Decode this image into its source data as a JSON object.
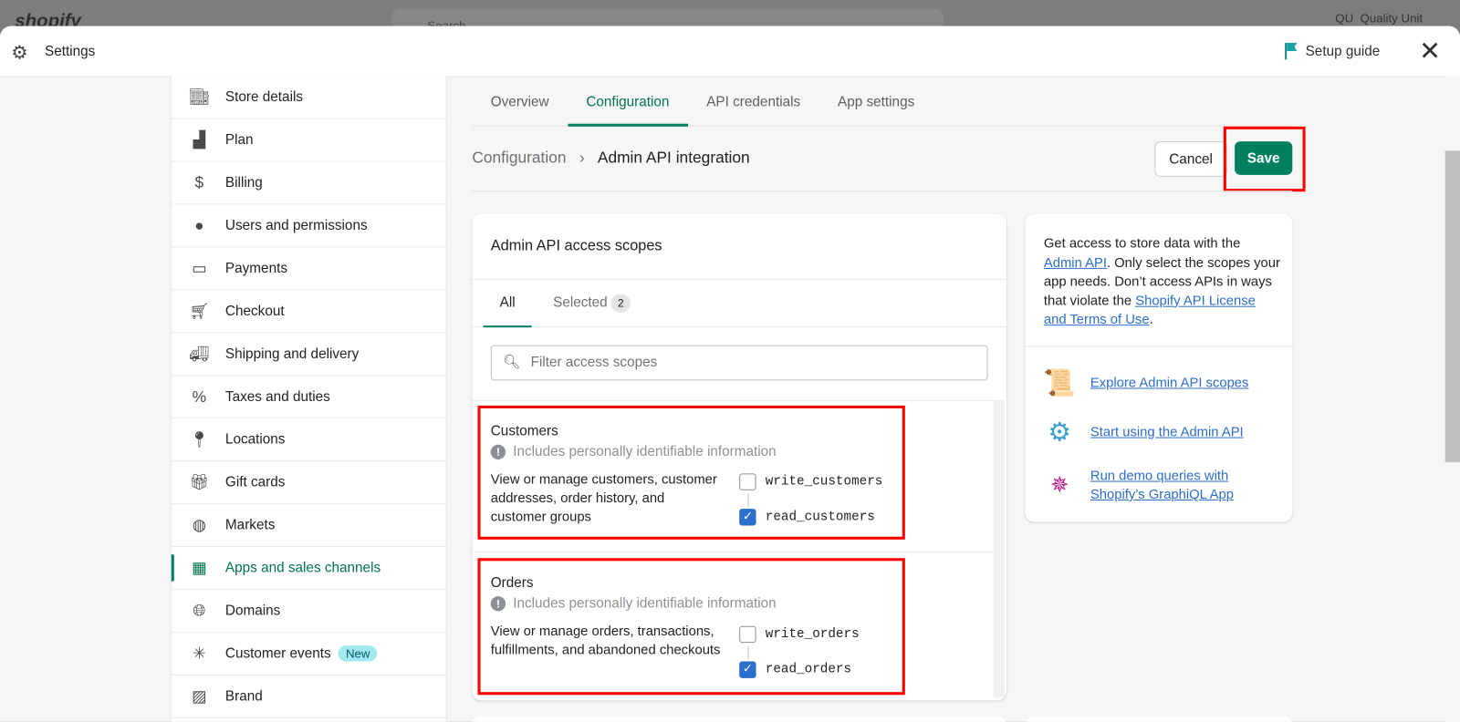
{
  "background": {
    "logo": "shopify",
    "search_placeholder": "Search",
    "user_initials": "QU",
    "user_name": "Quality Unit"
  },
  "header": {
    "title": "Settings",
    "setup_guide": "Setup guide"
  },
  "sidebar": {
    "items": [
      {
        "label": "Store details",
        "icon": "store-icon"
      },
      {
        "label": "Plan",
        "icon": "plan-icon"
      },
      {
        "label": "Billing",
        "icon": "billing-icon"
      },
      {
        "label": "Users and permissions",
        "icon": "user-icon"
      },
      {
        "label": "Payments",
        "icon": "payments-icon"
      },
      {
        "label": "Checkout",
        "icon": "cart-icon"
      },
      {
        "label": "Shipping and delivery",
        "icon": "truck-icon"
      },
      {
        "label": "Taxes and duties",
        "icon": "tax-icon"
      },
      {
        "label": "Locations",
        "icon": "location-icon"
      },
      {
        "label": "Gift cards",
        "icon": "gift-icon"
      },
      {
        "label": "Markets",
        "icon": "globe-icon"
      },
      {
        "label": "Apps and sales channels",
        "icon": "apps-icon",
        "active": true
      },
      {
        "label": "Domains",
        "icon": "domain-icon"
      },
      {
        "label": "Customer events",
        "icon": "cursor-click-icon",
        "badge": "New"
      },
      {
        "label": "Brand",
        "icon": "brand-icon"
      }
    ]
  },
  "tabs": [
    {
      "label": "Overview"
    },
    {
      "label": "Configuration",
      "active": true
    },
    {
      "label": "API credentials"
    },
    {
      "label": "App settings"
    }
  ],
  "breadcrumb": {
    "parent": "Configuration",
    "current": "Admin API integration"
  },
  "actions": {
    "cancel": "Cancel",
    "save": "Save"
  },
  "scopes_card": {
    "title": "Admin API access scopes",
    "subtabs": {
      "all": "All",
      "selected": "Selected",
      "selected_count": "2"
    },
    "filter_placeholder": "Filter access scopes",
    "groups": [
      {
        "name": "Customers",
        "pii": "Includes personally identifiable information",
        "description": "View or manage customers, customer addresses, order history, and customer groups",
        "write": {
          "label": "write_customers",
          "checked": false
        },
        "read": {
          "label": "read_customers",
          "checked": true
        }
      },
      {
        "name": "Orders",
        "pii": "Includes personally identifiable information",
        "description": "View or manage orders, transactions, fulfillments, and abandoned checkouts",
        "write": {
          "label": "write_orders",
          "checked": false
        },
        "read": {
          "label": "read_orders",
          "checked": true
        }
      }
    ]
  },
  "info_card": {
    "text1": "Get access to store data with the ",
    "link1": "Admin API",
    "text2": ". Only select the scopes your app needs. Don’t access APIs in ways that violate the ",
    "link2": "Shopify API License and Terms of Use",
    "text3": ".",
    "links": [
      {
        "label": "Explore Admin API scopes",
        "icon": "scroll-icon"
      },
      {
        "label": "Start using the Admin API",
        "icon": "gear-icon"
      },
      {
        "label": "Run demo queries with Shopify’s GraphiQL App",
        "icon": "graphql-icon"
      }
    ]
  },
  "colors": {
    "primary": "#008060",
    "highlight": "#ff0000",
    "link": "#2c6ecb",
    "checkbox": "#2c6ecb"
  }
}
